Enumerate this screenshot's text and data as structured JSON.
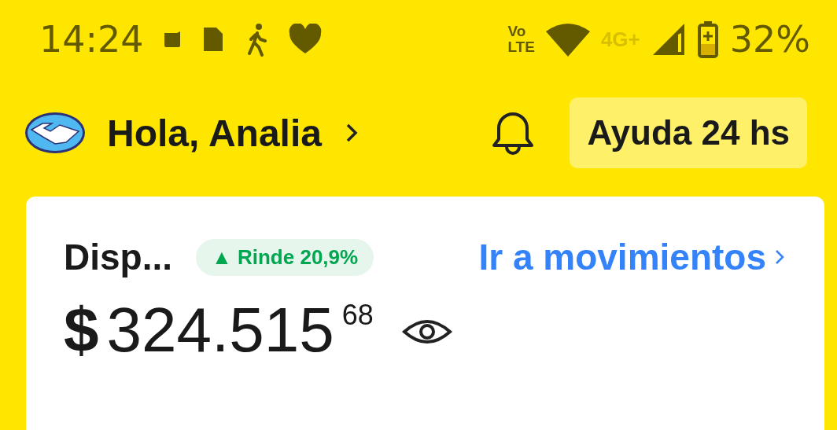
{
  "status_bar": {
    "time": "14:24",
    "volte": [
      "Vo",
      "LTE"
    ],
    "network_type": "4G+",
    "battery": "32%"
  },
  "header": {
    "greeting": "Hola, Analia",
    "help_button": "Ayuda 24 hs"
  },
  "account_card": {
    "title": "Disp...",
    "yield_badge": "▲ Rinde 20,9%",
    "link": "Ir a movimientos",
    "currency": "$",
    "amount": "324.515",
    "cents": "68"
  }
}
